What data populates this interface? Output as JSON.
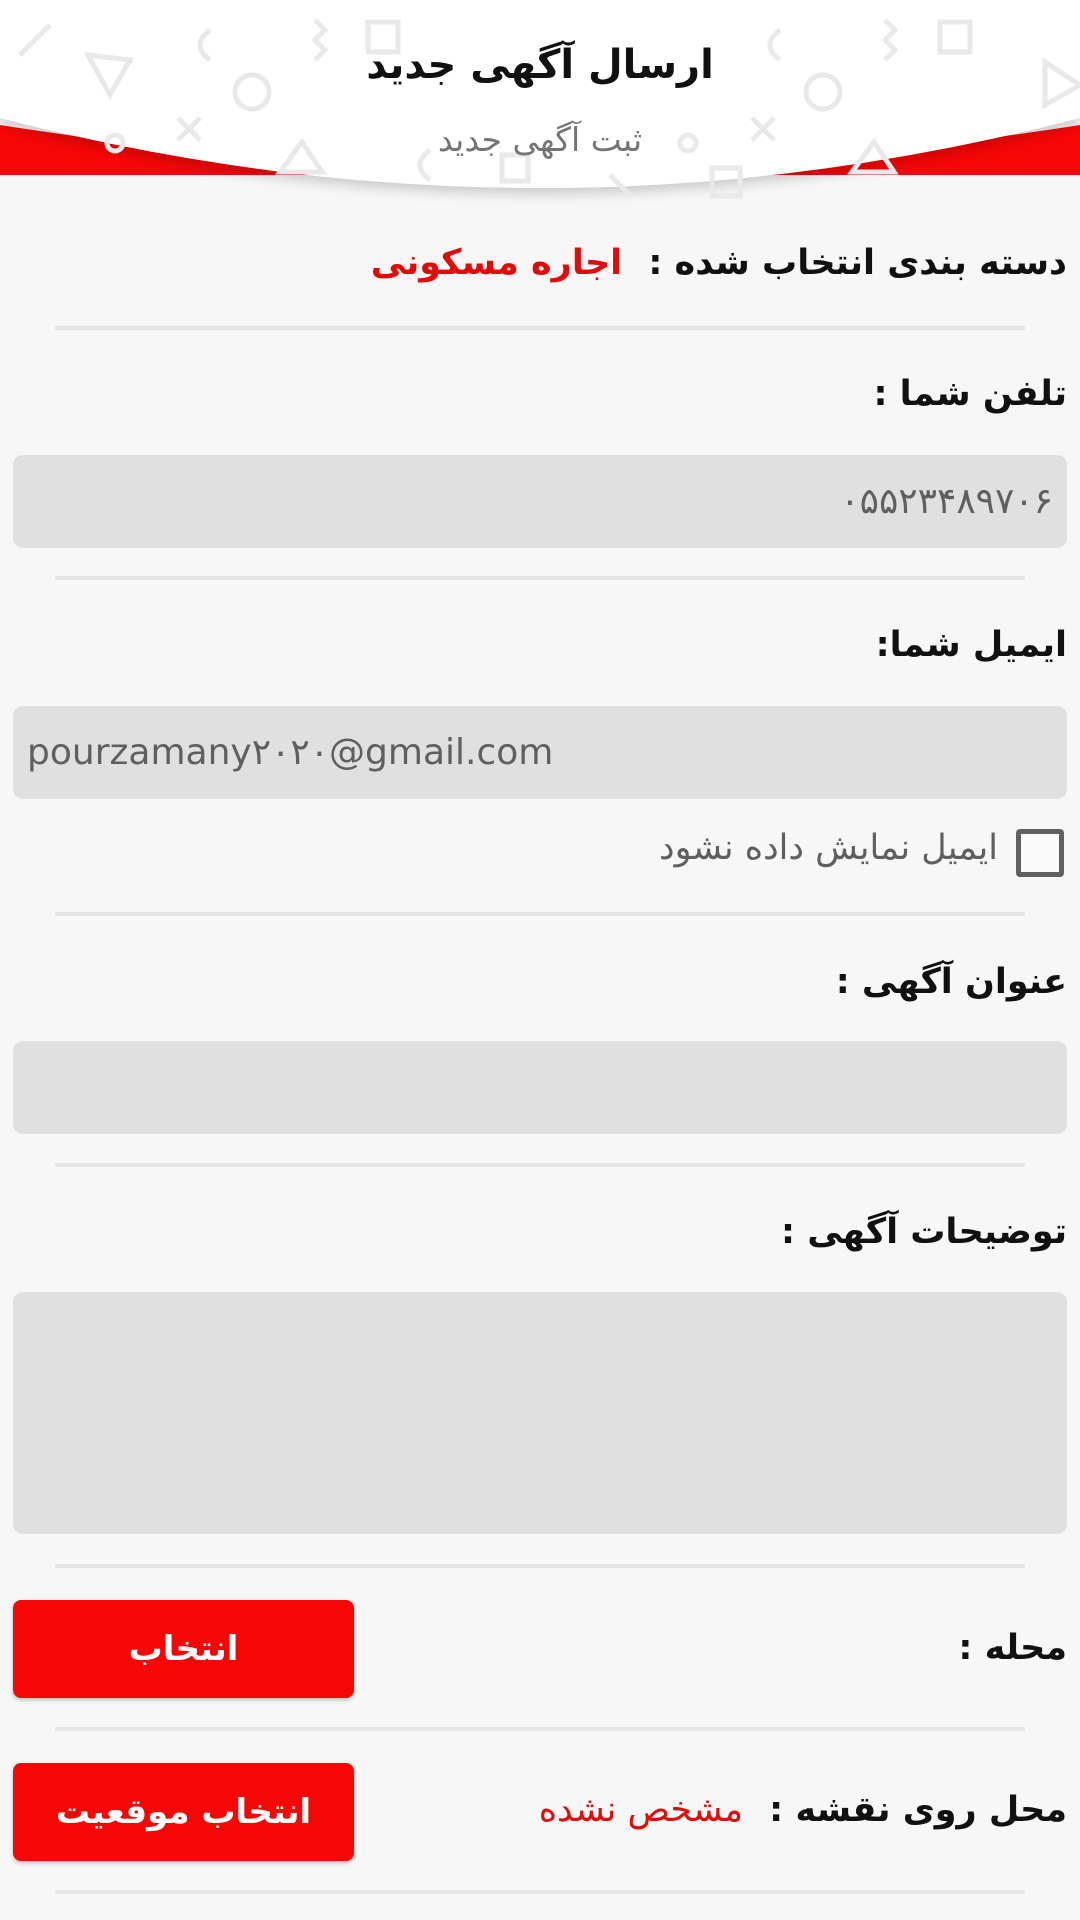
{
  "header": {
    "title": "ارسال آگهی جدید",
    "subtitle": "ثبت آگهی جدید"
  },
  "category": {
    "label": "دسته بندی انتخاب شده :",
    "value": "اجاره مسکونی"
  },
  "phone": {
    "label": "تلفن شما :",
    "value": "۰۵۵۲۳۴۸۹۷۰۶"
  },
  "email": {
    "label": "ایمیل شما:",
    "value": "pourzamany۲۰۲۰@gmail.com",
    "hide_label": "ایمیل نمایش داده نشود",
    "hide_checked": false
  },
  "ad_title": {
    "label": "عنوان آگهی :",
    "value": ""
  },
  "description": {
    "label": "توضیحات آگهی :",
    "value": ""
  },
  "neighborhood": {
    "label": "محله :",
    "button": "انتخاب"
  },
  "map_location": {
    "label": "محل روی نقشه :",
    "value": "مشخص نشده",
    "button": "انتخاب موقعیت"
  },
  "colors": {
    "accent": "#f70606",
    "accent_text": "#e30a0a",
    "field_bg": "#e0e0e0",
    "page_bg": "#f7f7f7"
  }
}
